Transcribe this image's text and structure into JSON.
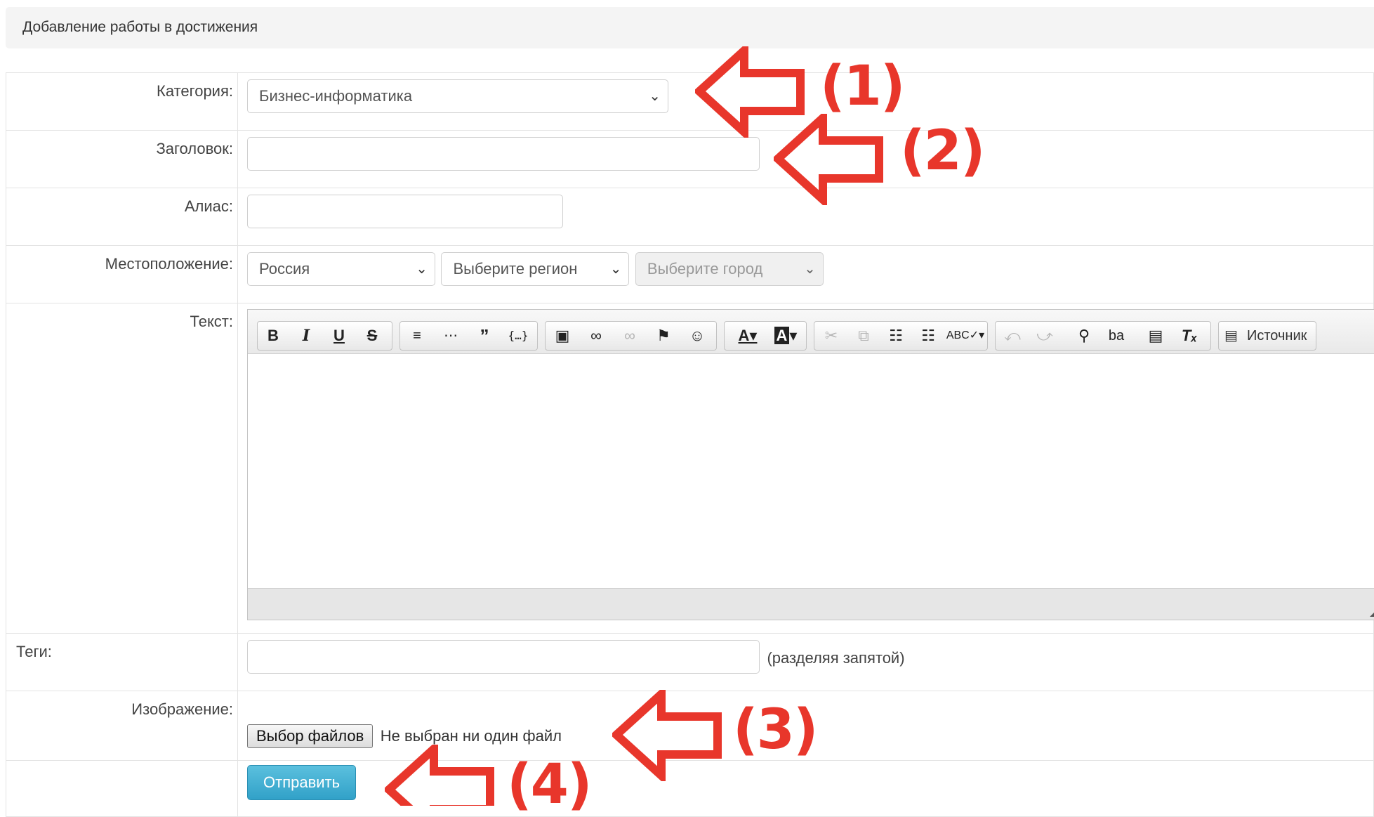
{
  "header": {
    "title": "Добавление работы в достижения"
  },
  "form": {
    "category": {
      "label": "Категория:",
      "value": "Бизнес-информатика"
    },
    "title_field": {
      "label": "Заголовок:",
      "value": ""
    },
    "alias": {
      "label": "Алиас:",
      "value": ""
    },
    "location": {
      "label": "Местоположение:",
      "country": "Россия",
      "region": "Выберите регион",
      "city": "Выберите город"
    },
    "text": {
      "label": "Текст:",
      "source_label": "Источник"
    },
    "tags": {
      "label": "Теги:",
      "hint": "(разделяя запятой)",
      "value": ""
    },
    "image": {
      "label": "Изображение:",
      "choose_label": "Выбор файлов",
      "status": "Не выбран ни один файл"
    },
    "submit_label": "Отправить"
  },
  "annotations": {
    "color": "#e8362b",
    "labels": [
      "(1)",
      "(2)",
      "(3)",
      "(4)"
    ]
  }
}
